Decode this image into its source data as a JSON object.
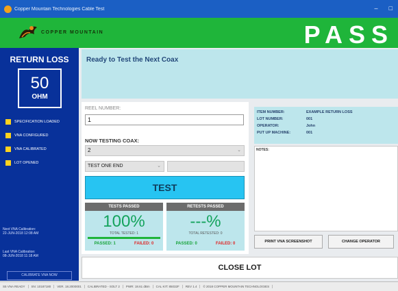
{
  "window": {
    "title": "Copper Mountain Technologies Cable Test"
  },
  "brand": {
    "name": "COPPER MOUNTAIN",
    "result": "PASS"
  },
  "sidebar": {
    "title": "RETURN LOSS",
    "impedance_value": "50",
    "impedance_unit": "OHM",
    "status_items": [
      {
        "label": "SPECIFICATION LOADED"
      },
      {
        "label": "VNA CONFIGURED"
      },
      {
        "label": "VNA CALIBRATED"
      },
      {
        "label": "LOT OPENED"
      }
    ],
    "calibration": {
      "next_label": "Next VNA Calibration:",
      "next_value": "22-JUN-2018 12:08 AM",
      "last_label": "Last VNA Calibration:",
      "last_value": "08-JUN-2018 11:18 AM",
      "button_label": "CALIBRATE VNA NOW"
    }
  },
  "status_message": "Ready to Test the Next Coax",
  "reel": {
    "label": "REEL NUMBER:",
    "value": "1"
  },
  "now_testing": {
    "label": "NOW TESTING COAX:",
    "value": "2"
  },
  "test_mode": {
    "value": "TEST ONE END"
  },
  "test_button_label": "TEST",
  "tests_passed": {
    "header": "TESTS PASSED",
    "percent": "100%",
    "total_label": "TOTAL TESTED: 1",
    "passed": "PASSED: 1",
    "failed": "FAILED: 0",
    "ratio": 1.0
  },
  "retests_passed": {
    "header": "RETESTS PASSED",
    "percent": "---%",
    "total_label": "TOTAL RETESTED: 0",
    "passed": "PASSED: 0",
    "failed": "FAILED: 0",
    "ratio": 0
  },
  "info": {
    "rows": [
      {
        "key": "ITEM NUMBER:",
        "value": "EXAMPLE RETURN LOSS"
      },
      {
        "key": "LOT NUMBER:",
        "value": "001"
      },
      {
        "key": "OPERATOR:",
        "value": "John"
      },
      {
        "key": "PUT UP MACHINE:",
        "value": "001"
      }
    ]
  },
  "notes": {
    "label": "NOTES:"
  },
  "buttons": {
    "print": "PRINT VNA SCREENSHOT",
    "change_operator": "CHANGE OPERATOR",
    "close_lot": "CLOSE LOT"
  },
  "statusbar": [
    "S5 VNA READY",
    "SN: 10187180",
    "VER. 18.2000001",
    "CALIBRATED - SOLT 2",
    "PWR: 18.61 dBm",
    "CAL KIT: 85032F",
    "REV 1.4",
    "© 2018 COPPER MOUNTAIN TECHNOLOGIES"
  ],
  "colors": {
    "title_bar": "#1b5fc4",
    "brand_green": "#1fb53a",
    "sidebar_blue": "#08319a",
    "panel_cyan": "#bde6ec",
    "test_button": "#27c4f2",
    "status_yellow": "#ffd21f",
    "pass_green": "#17a33a",
    "fail_red": "#e02424"
  }
}
